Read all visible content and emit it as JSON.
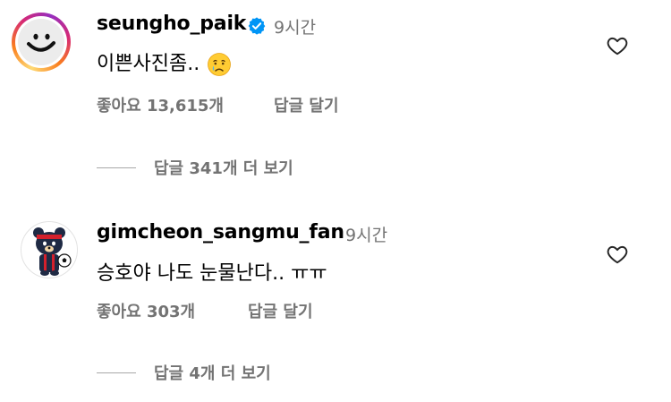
{
  "comments": [
    {
      "username": "seungho_paik",
      "verified": true,
      "time": "9시간",
      "text": "이쁜사진좀..",
      "emoji": "crying-face",
      "likes_text": "좋아요 13,615개",
      "reply_label": "답글 달기",
      "view_replies": "답글 341개 더 보기"
    },
    {
      "username": "gimcheon_sangmu_fan",
      "verified": false,
      "time": "9시간",
      "text": "승호야 나도 눈물난다.. ㅠㅠ",
      "likes_text": "좋아요 303개",
      "reply_label": "답글 달기",
      "view_replies": "답글 4개 더 보기"
    }
  ],
  "colors": {
    "secondary_text": "#737373",
    "verified_blue": "#0095f6",
    "heart_stroke": "#262626"
  }
}
